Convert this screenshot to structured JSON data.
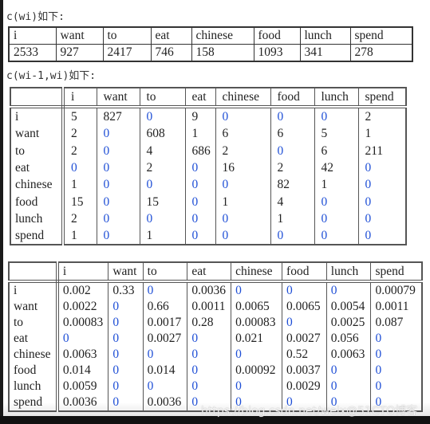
{
  "unigram": {
    "label": "c(wi)如下:",
    "headers": [
      "i",
      "want",
      "to",
      "eat",
      "chinese",
      "food",
      "lunch",
      "spend"
    ],
    "counts": [
      "2533",
      "927",
      "2417",
      "746",
      "158",
      "1093",
      "341",
      "278"
    ]
  },
  "bigram_counts": {
    "label": "c(wi-1,wi)如下:",
    "headers": [
      "",
      "i",
      "want",
      "to",
      "eat",
      "chinese",
      "food",
      "lunch",
      "spend"
    ],
    "rows": [
      [
        "i",
        "5",
        "827",
        "0",
        "9",
        "0",
        "0",
        "0",
        "2"
      ],
      [
        "want",
        "2",
        "0",
        "608",
        "1",
        "6",
        "6",
        "5",
        "1"
      ],
      [
        "to",
        "2",
        "0",
        "4",
        "686",
        "2",
        "0",
        "6",
        "211"
      ],
      [
        "eat",
        "0",
        "0",
        "2",
        "0",
        "16",
        "2",
        "42",
        "0"
      ],
      [
        "chinese",
        "1",
        "0",
        "0",
        "0",
        "0",
        "82",
        "1",
        "0"
      ],
      [
        "food",
        "15",
        "0",
        "15",
        "0",
        "1",
        "4",
        "0",
        "0"
      ],
      [
        "lunch",
        "2",
        "0",
        "0",
        "0",
        "0",
        "1",
        "0",
        "0"
      ],
      [
        "spend",
        "1",
        "0",
        "1",
        "0",
        "0",
        "0",
        "0",
        "0"
      ]
    ]
  },
  "bigram_probs": {
    "headers": [
      "",
      "i",
      "want",
      "to",
      "eat",
      "chinese",
      "food",
      "lunch",
      "spend"
    ],
    "rows": [
      [
        "i",
        "0.002",
        "0.33",
        "0",
        "0.0036",
        "0",
        "0",
        "0",
        "0.00079"
      ],
      [
        "want",
        "0.0022",
        "0",
        "0.66",
        "0.0011",
        "0.0065",
        "0.0065",
        "0.0054",
        "0.0011"
      ],
      [
        "to",
        "0.00083",
        "0",
        "0.0017",
        "0.28",
        "0.00083",
        "0",
        "0.0025",
        "0.087"
      ],
      [
        "eat",
        "0",
        "0",
        "0.0027",
        "0",
        "0.021",
        "0.0027",
        "0.056",
        "0"
      ],
      [
        "chinese",
        "0.0063",
        "0",
        "0",
        "0",
        "0",
        "0.52",
        "0.0063",
        "0"
      ],
      [
        "food",
        "0.014",
        "0",
        "0.014",
        "0",
        "0.00092",
        "0.0037",
        "0",
        "0"
      ],
      [
        "lunch",
        "0.0059",
        "0",
        "0",
        "0",
        "0",
        "0.0029",
        "0",
        "0"
      ],
      [
        "spend",
        "0.0036",
        "0",
        "0.0036",
        "0",
        "0",
        "0",
        "0",
        "0"
      ]
    ]
  },
  "colors": {
    "zero_highlight": "#1f4fd6"
  },
  "watermark": "https://blog.csdn.net/weix@51CTO博客"
}
